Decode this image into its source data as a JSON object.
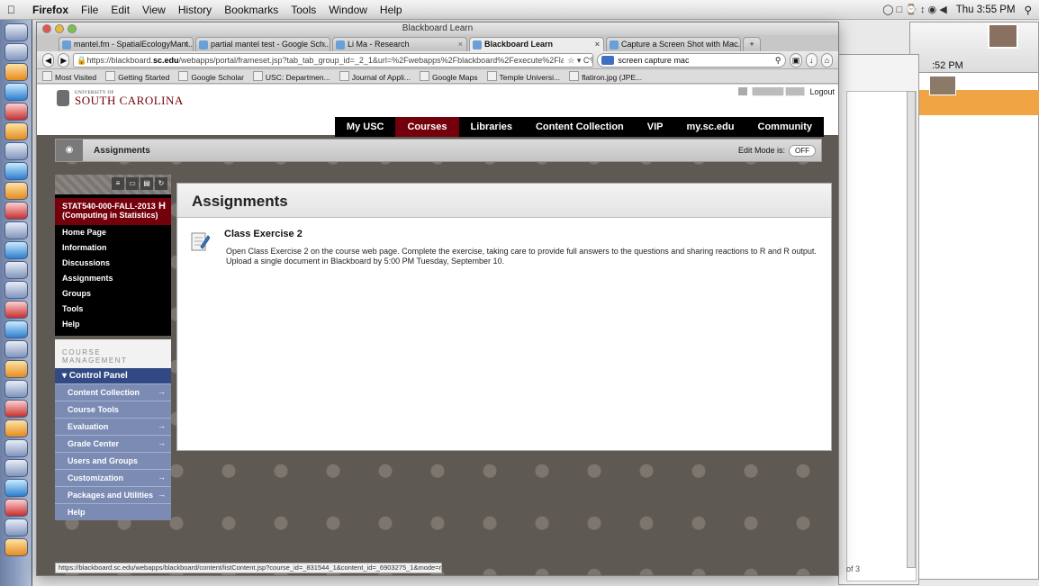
{
  "menubar": {
    "app": "Firefox",
    "items": [
      "File",
      "Edit",
      "View",
      "History",
      "Bookmarks",
      "Tools",
      "Window",
      "Help"
    ],
    "clock": "Thu 3:55 PM"
  },
  "bg_window": {
    "clock": ":52 PM",
    "doc_label": "of 3"
  },
  "browser": {
    "title": "Blackboard Learn",
    "tabs": [
      {
        "label": "mantel.fm - SpatialEcologyMant..."
      },
      {
        "label": "partial mantel test - Google Sch..."
      },
      {
        "label": "Li Ma - Research"
      },
      {
        "label": "Blackboard Learn"
      },
      {
        "label": "Capture a Screen Shot with Mac..."
      }
    ],
    "new_tab": "+",
    "url_prefix": "https://blackboard.",
    "url_domain": "sc.edu",
    "url_rest": "/webapps/portal/frameset.jsp?tab_tab_group_id=_2_1&url=%2Fwebapps%2Fblackboard%2Fexecute%2Flauncher%3Ftype%3DCo",
    "search_value": "screen capture mac",
    "bookmarks": [
      "Most Visited",
      "Getting Started",
      "Google Scholar",
      "USC: Departmen...",
      "Journal of Appli...",
      "Google Maps",
      "Temple Universi...",
      "flatiron.jpg (JPE..."
    ],
    "status_url": "https://blackboard.sc.edu/webapps/blackboard/content/listContent.jsp?course_id=_831544_1&content_id=_6903275_1&mode=reset"
  },
  "header": {
    "logo_small": "UNIVERSITY OF",
    "logo_main": "SOUTH CAROLINA",
    "logout": "Logout",
    "nav": [
      "My USC",
      "Courses",
      "Libraries",
      "Content Collection",
      "VIP",
      "my.sc.edu",
      "Community"
    ]
  },
  "breadcrumb": {
    "current": "Assignments",
    "edit_mode_label": "Edit Mode is:",
    "edit_mode_value": "OFF"
  },
  "sidebar": {
    "course": "STAT540-000-FALL-2013 (Computing in Statistics)",
    "links": [
      "Home Page",
      "Information",
      "Discussions",
      "Assignments",
      "Groups",
      "Tools",
      "Help"
    ],
    "management_title": "COURSE MANAGEMENT",
    "control_panel": "Control Panel",
    "cp_items": [
      {
        "label": "Content Collection",
        "arrow": true
      },
      {
        "label": "Course Tools",
        "arrow": false
      },
      {
        "label": "Evaluation",
        "arrow": true
      },
      {
        "label": "Grade Center",
        "arrow": true
      },
      {
        "label": "Users and Groups",
        "arrow": false
      },
      {
        "label": "Customization",
        "arrow": true
      },
      {
        "label": "Packages and Utilities",
        "arrow": true
      },
      {
        "label": "Help",
        "arrow": false
      }
    ]
  },
  "main": {
    "page_title": "Assignments",
    "item_title": "Class Exercise 2",
    "item_desc": "Open Class Exercise 2 on the course web page.  Complete the exercise, taking care to provide full answers to the questions and sharing reactions to R and R output.\nUpload  a single document in Blackboard by 5:00  PM Tuesday, September 10."
  },
  "colors": {
    "garnet": "#73000a",
    "control_panel": "#324a83",
    "cp_item": "#7b8bb3"
  }
}
